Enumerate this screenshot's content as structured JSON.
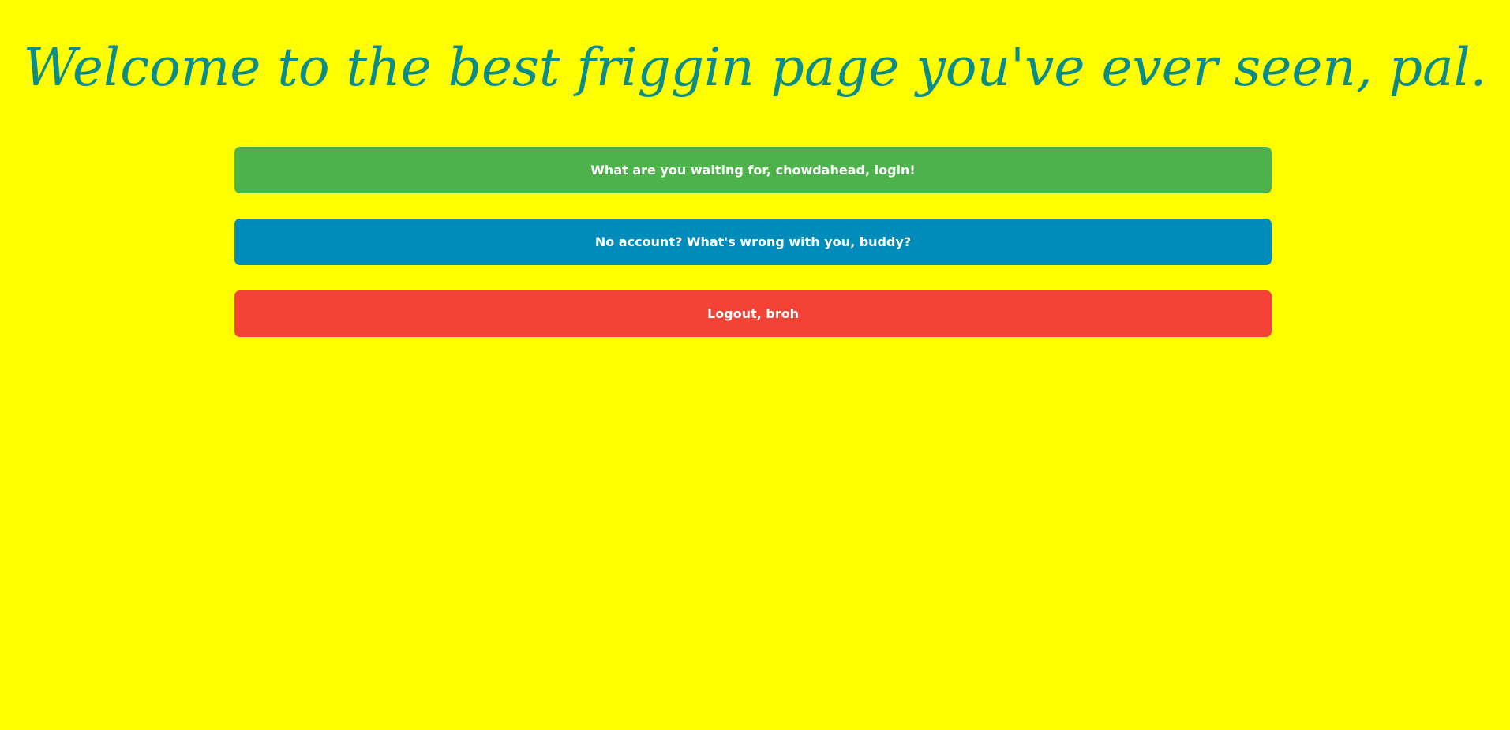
{
  "page": {
    "title": "Welcome to the best friggin page you've ever seen, pal.",
    "background_color": "#ffff00",
    "title_color": "#0c8c86"
  },
  "buttons": {
    "login": {
      "label": "What are you waiting for, chowdahead, login!",
      "color": "#4db14c"
    },
    "signup": {
      "label": "No account? What's wrong with you, buddy?",
      "color": "#008cba"
    },
    "logout": {
      "label": "Logout, broh",
      "color": "#f44336"
    }
  }
}
